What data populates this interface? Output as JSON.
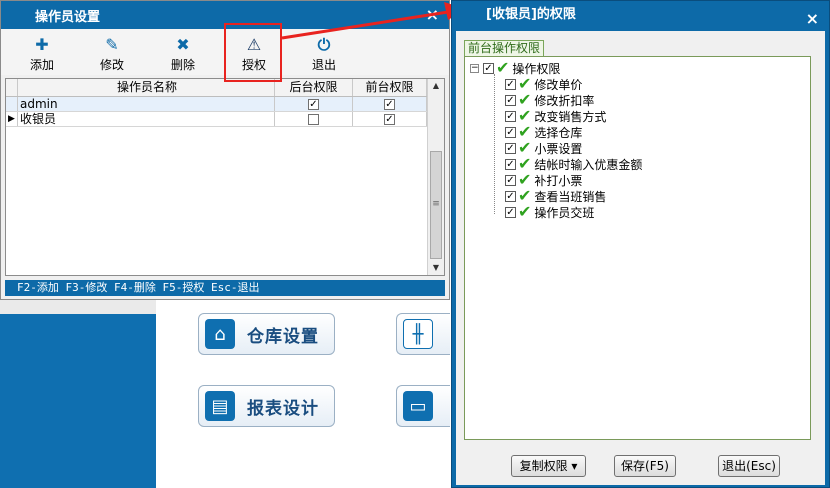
{
  "operator_window": {
    "title": "操作员设置",
    "close": "×",
    "toolbar": [
      {
        "label": "添加",
        "icon": "plus-icon",
        "glyph": "✚"
      },
      {
        "label": "修改",
        "icon": "pencil-icon",
        "glyph": "✎"
      },
      {
        "label": "删除",
        "icon": "delete-x-icon",
        "glyph": "✖"
      },
      {
        "label": "授权",
        "icon": "warning-triangle-icon",
        "glyph": "⚠"
      },
      {
        "label": "退出",
        "icon": "power-icon",
        "glyph": "⏻"
      }
    ],
    "grid": {
      "columns": [
        "操作员名称",
        "后台权限",
        "前台权限"
      ],
      "rows": [
        {
          "name": "admin",
          "back": true,
          "front": true
        },
        {
          "name": "收银员",
          "back": false,
          "front": true
        }
      ]
    },
    "status_bar": "F2-添加 F3-修改 F4-删除 F5-授权 Esc-退出"
  },
  "background_buttons": [
    {
      "label": "仓库设置",
      "icon": "house-icon"
    },
    {
      "label": "报表设计",
      "icon": "report-icon"
    }
  ],
  "permission_window": {
    "title": "[收银员]的权限",
    "close": "×",
    "tab": "前台操作权限",
    "tree": {
      "root": {
        "label": "操作权限",
        "checked": true,
        "expander": "−"
      },
      "children": [
        {
          "label": "修改单价",
          "checked": true
        },
        {
          "label": "修改折扣率",
          "checked": true
        },
        {
          "label": "改变销售方式",
          "checked": true
        },
        {
          "label": "选择仓库",
          "checked": true
        },
        {
          "label": "小票设置",
          "checked": true
        },
        {
          "label": "结帐时输入优惠金额",
          "checked": true
        },
        {
          "label": "补打小票",
          "checked": true
        },
        {
          "label": "查看当班销售",
          "checked": true
        },
        {
          "label": "操作员交班",
          "checked": true
        }
      ]
    },
    "buttons": {
      "copy": "复制权限 ▾",
      "save": "保存(F5)",
      "exit": "退出(Esc)"
    }
  },
  "colors": {
    "title_blue": "#0d6aa8",
    "highlight_red": "#e8231f",
    "check_green": "#2fa21f"
  }
}
